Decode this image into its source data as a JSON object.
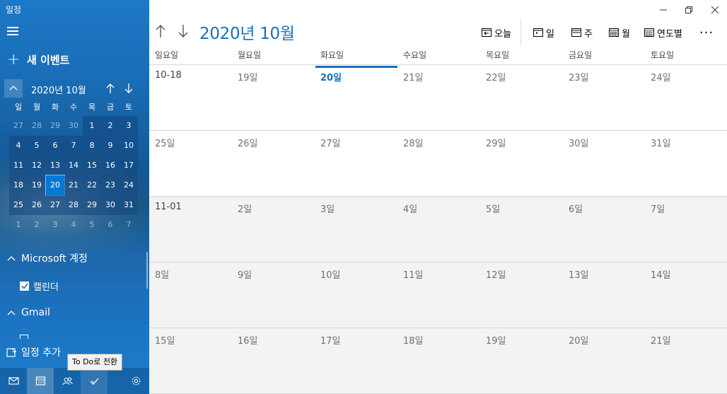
{
  "app": {
    "title": "일정"
  },
  "sidebar": {
    "new_event_label": "새 이벤트",
    "mini_calendar": {
      "month_label": "2020년 10월",
      "weekdays": [
        "일",
        "월",
        "화",
        "수",
        "목",
        "금",
        "토"
      ],
      "weeks": [
        [
          "27",
          "28",
          "29",
          "30",
          "1",
          "2",
          "3"
        ],
        [
          "4",
          "5",
          "6",
          "7",
          "8",
          "9",
          "10"
        ],
        [
          "11",
          "12",
          "13",
          "14",
          "15",
          "16",
          "17"
        ],
        [
          "18",
          "19",
          "20",
          "21",
          "22",
          "23",
          "24"
        ],
        [
          "25",
          "26",
          "27",
          "28",
          "29",
          "30",
          "31"
        ],
        [
          "1",
          "2",
          "3",
          "4",
          "5",
          "6",
          "7"
        ]
      ],
      "today": "20"
    },
    "accounts": [
      {
        "name": "Microsoft 계정",
        "calendars": [
          {
            "name": "캘린더",
            "checked": true
          }
        ]
      },
      {
        "name": "Gmail"
      }
    ],
    "add_calendar_label": "일정 추가",
    "tooltip": "To Do로 전환",
    "bottom_icons": [
      "mail-icon",
      "calendar-icon",
      "people-icon",
      "todo-icon",
      "settings-icon"
    ]
  },
  "header": {
    "month_title": "2020년 10월",
    "toolbar": {
      "today_label": "오늘",
      "day_label": "일",
      "week_label": "주",
      "month_label": "월",
      "year_label": "연도별",
      "more_label": "···"
    }
  },
  "calendar": {
    "weekday_headers": [
      "일요일",
      "월요일",
      "화요일",
      "수요일",
      "목요일",
      "금요일",
      "토요일"
    ],
    "weeks": [
      [
        "10-18",
        "19일",
        "20일",
        "21일",
        "22일",
        "23일",
        "24일"
      ],
      [
        "25일",
        "26일",
        "27일",
        "28일",
        "29일",
        "30일",
        "31일"
      ],
      [
        "11-01",
        "2일",
        "3일",
        "4일",
        "5일",
        "6일",
        "7일"
      ],
      [
        "8일",
        "9일",
        "10일",
        "11일",
        "12일",
        "13일",
        "14일"
      ],
      [
        "15일",
        "16일",
        "17일",
        "18일",
        "19일",
        "20일",
        "21일"
      ]
    ],
    "today_label": "20일"
  },
  "colors": {
    "accent": "#1a6fb8",
    "today_highlight": "#0078d7",
    "other_month_row_bg": "#f3f3f3"
  }
}
